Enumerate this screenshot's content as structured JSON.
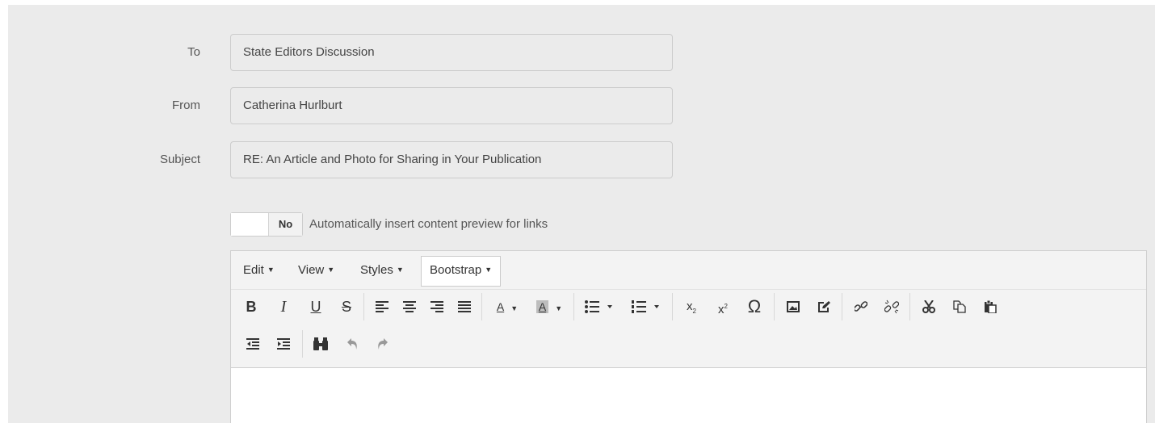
{
  "form": {
    "to": {
      "label": "To",
      "value": "State Editors Discussion"
    },
    "from": {
      "label": "From",
      "value": "Catherina Hurlburt"
    },
    "subject": {
      "label": "Subject",
      "value": "RE: An Article and Photo for Sharing in Your Publication"
    }
  },
  "link_preview": {
    "toggle_state": "No",
    "toggle_on": false,
    "label": "Automatically insert content preview for links"
  },
  "editor": {
    "menubar": [
      {
        "label": "Edit",
        "caret": "▼"
      },
      {
        "label": "View",
        "caret": "▼"
      },
      {
        "label": "Styles",
        "caret": "▼"
      },
      {
        "label": "Bootstrap",
        "caret": "▼",
        "active": true
      }
    ],
    "toolbar": {
      "bold": "B",
      "italic": "I",
      "underline": "U",
      "strikethrough": "S",
      "font_color_letter": "A",
      "bg_color_letter": "A",
      "dropdown_caret": "▼",
      "omega": "Ω",
      "icons": [
        "bold-icon",
        "italic-icon",
        "underline-icon",
        "strikethrough-icon",
        "align-left-icon",
        "align-center-icon",
        "align-right-icon",
        "align-justify-icon",
        "text-color-icon",
        "background-color-icon",
        "bullet-list-icon",
        "numbered-list-icon",
        "subscript-icon",
        "superscript-icon",
        "special-character-icon",
        "image-icon",
        "edit-image-icon",
        "link-icon",
        "unlink-icon",
        "cut-icon",
        "copy-icon",
        "paste-icon",
        "outdent-icon",
        "indent-icon",
        "find-replace-icon",
        "undo-icon",
        "redo-icon"
      ]
    },
    "body_text": ""
  },
  "colors": {
    "panel_bg": "#ebebeb",
    "field_border": "#cccccc",
    "editor_bg": "#f3f3f3",
    "content_bg": "#ffffff"
  }
}
